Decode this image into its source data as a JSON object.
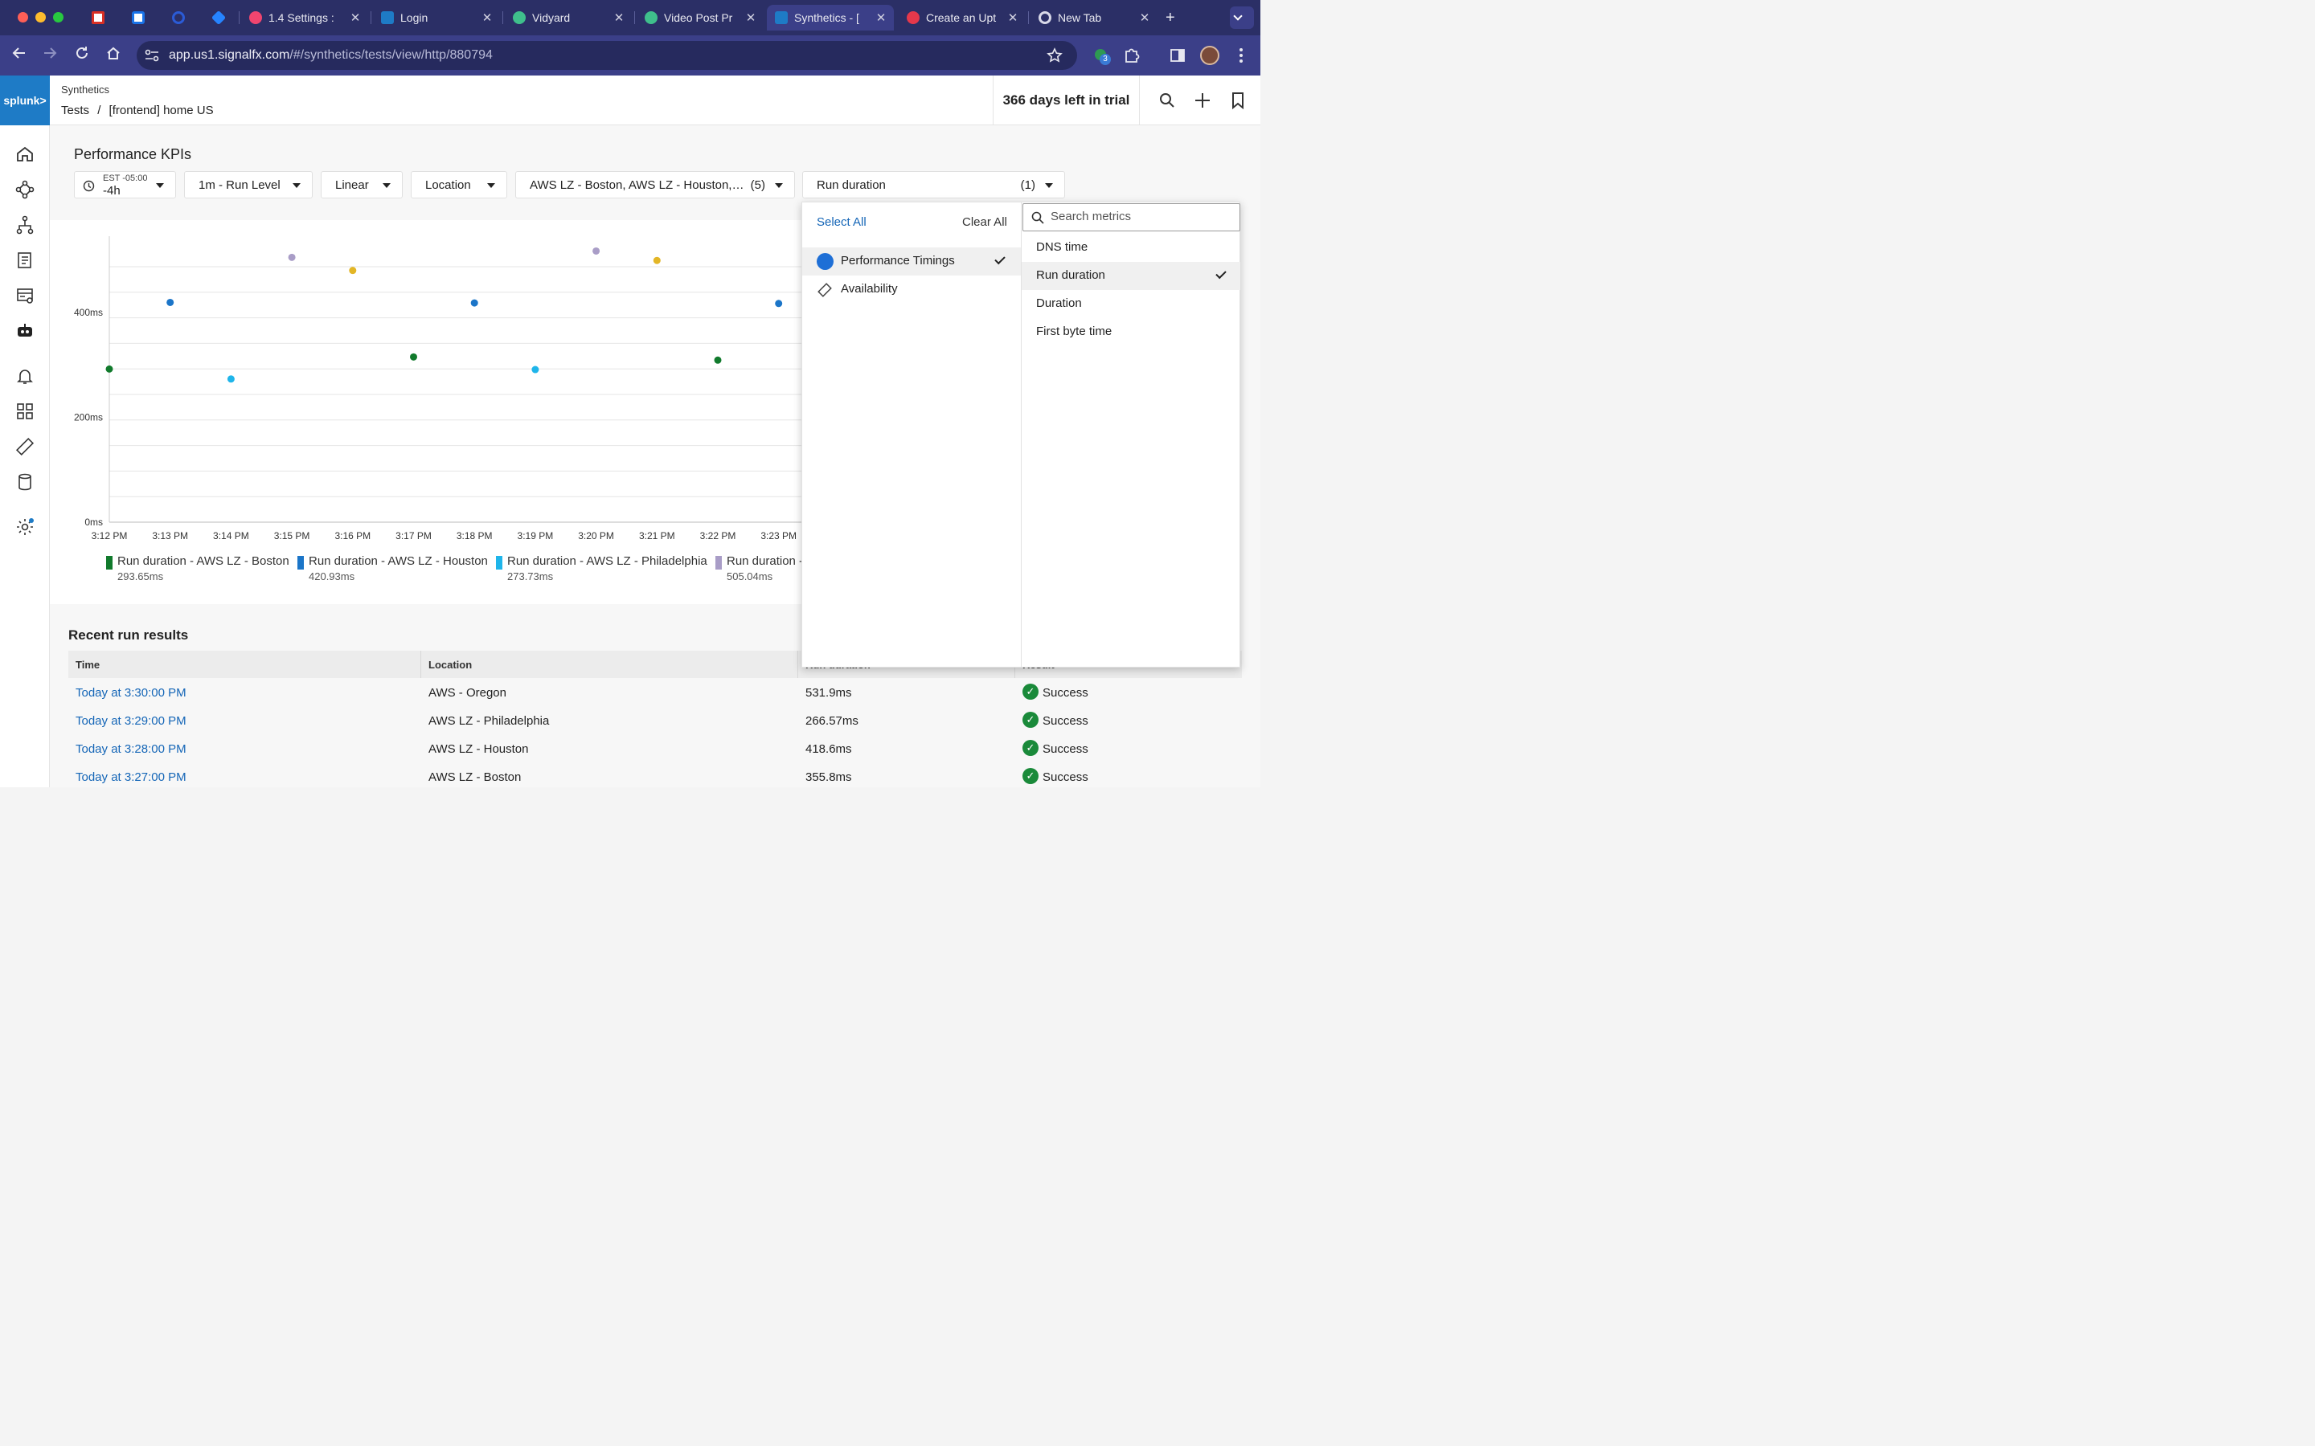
{
  "browser": {
    "tabs": [
      {
        "label": "",
        "kind": "gmail"
      },
      {
        "label": "",
        "kind": "calendar"
      },
      {
        "label": "",
        "kind": "circle"
      },
      {
        "label": "",
        "kind": "jira"
      },
      {
        "label": "1.4 Settings :",
        "kind": "pink"
      },
      {
        "label": "Login",
        "kind": "splunk"
      },
      {
        "label": "Vidyard",
        "kind": "vidyard"
      },
      {
        "label": "Video Post Pr",
        "kind": "vidyard"
      },
      {
        "label": "Synthetics - [",
        "kind": "splunk",
        "active": true
      },
      {
        "label": "Create an Upt",
        "kind": "red"
      },
      {
        "label": "New Tab",
        "kind": "chrome"
      }
    ],
    "close_glyph": "✕",
    "new_tab_glyph": "+",
    "url_host": "app.us1.signalfx.com",
    "url_path": "/#/synthetics/tests/view/http/880794",
    "extension_badge": "3"
  },
  "app": {
    "logo": "splunk>",
    "header": {
      "app_name": "Synthetics",
      "crumb_parent": "Tests",
      "crumb_sep": "/",
      "crumb_current": "[frontend] home US",
      "trial": "366 days left in trial"
    },
    "sidebar_icons": [
      "home-icon",
      "topology-icon",
      "hierarchy-icon",
      "log-icon",
      "infrastructure-icon",
      "synthetics-robot-icon",
      "alert-bell-icon",
      "dashboard-grid-icon",
      "ruler-icon",
      "database-icon",
      "settings-gear-icon"
    ],
    "kpi_title": "Performance KPIs",
    "filters": {
      "time_zone": "EST -05:00",
      "time_range": "-4h",
      "resolution": "1m - Run Level",
      "scale": "Linear",
      "group": "Location",
      "locations": "AWS LZ - Boston, AWS LZ - Houston,…",
      "locations_count": "(5)",
      "metric": "Run duration",
      "metric_count": "(1)"
    },
    "dropdown": {
      "select_all": "Select All",
      "clear_all": "Clear All",
      "categories": [
        {
          "label": "Performance Timings",
          "selected": true,
          "icon": "circle-icon"
        },
        {
          "label": "Availability",
          "selected": false,
          "icon": "tag-icon"
        }
      ],
      "search_placeholder": "Search metrics",
      "metrics": [
        {
          "label": "DNS time",
          "selected": false
        },
        {
          "label": "Run duration",
          "selected": true
        },
        {
          "label": "Duration",
          "selected": false
        },
        {
          "label": "First byte time",
          "selected": false
        }
      ]
    },
    "recent": {
      "title": "Recent run results",
      "columns": [
        "Time",
        "Location",
        "Run duration",
        "Result"
      ],
      "rows": [
        {
          "time": "Today at 3:30:00 PM",
          "location": "AWS - Oregon",
          "duration": "531.9ms",
          "result": "Success"
        },
        {
          "time": "Today at 3:29:00 PM",
          "location": "AWS LZ - Philadelphia",
          "duration": "266.57ms",
          "result": "Success"
        },
        {
          "time": "Today at 3:28:00 PM",
          "location": "AWS LZ - Houston",
          "duration": "418.6ms",
          "result": "Success"
        },
        {
          "time": "Today at 3:27:00 PM",
          "location": "AWS LZ - Boston",
          "duration": "355.8ms",
          "result": "Success"
        }
      ]
    }
  },
  "chart_data": {
    "type": "scatter",
    "y_ticks": [
      "0ms",
      "200ms",
      "400ms"
    ],
    "y_tick_values": [
      0,
      200,
      400
    ],
    "ylim": [
      0,
      530
    ],
    "x_labels": [
      "3:12 PM",
      "3:13 PM",
      "3:14 PM",
      "3:15 PM",
      "3:16 PM",
      "3:17 PM",
      "3:18 PM",
      "3:19 PM",
      "3:20 PM",
      "3:21 PM",
      "3:22 PM",
      "3:23 PM"
    ],
    "grid": true,
    "legend_position": "bottom",
    "series": [
      {
        "name": "Run duration - AWS LZ - Boston",
        "legend_value": "293.65ms",
        "color": "#117a2c",
        "points": [
          [
            0,
            292
          ],
          [
            5,
            315
          ],
          [
            10,
            309
          ]
        ]
      },
      {
        "name": "Run duration - AWS LZ - Houston",
        "legend_value": "420.93ms",
        "color": "#1b75c8",
        "points": [
          [
            1,
            419
          ],
          [
            6,
            418
          ],
          [
            11,
            417
          ]
        ]
      },
      {
        "name": "Run duration - AWS LZ - Philadelphia",
        "legend_value": "273.73ms",
        "color": "#1fb5ea",
        "points": [
          [
            2,
            273
          ],
          [
            7,
            291
          ]
        ]
      },
      {
        "name": "Run duration - ",
        "legend_value": "505.04ms",
        "color": "#a99dc7",
        "points": [
          [
            3,
            505
          ],
          [
            8,
            517
          ]
        ]
      },
      {
        "name": "",
        "legend_value": "",
        "color": "#e3b626",
        "points": [
          [
            4,
            480
          ],
          [
            9,
            499
          ]
        ]
      }
    ]
  }
}
